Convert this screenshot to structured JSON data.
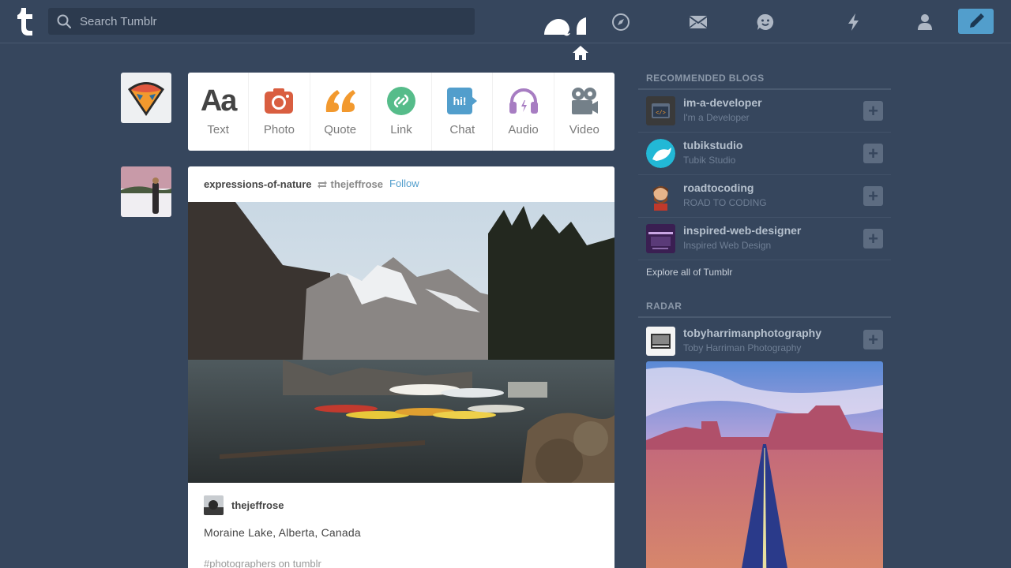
{
  "header": {
    "search_placeholder": "Search Tumblr",
    "nav_icons": [
      "home-icon",
      "explore-icon",
      "inbox-icon",
      "messaging-icon",
      "activity-icon",
      "account-icon"
    ],
    "compose_icon": "pencil-icon",
    "accent_color": "#529ecc",
    "background_color": "#36465d"
  },
  "post_types": [
    {
      "label": "Text",
      "icon": "text-icon",
      "color": "#444444"
    },
    {
      "label": "Photo",
      "icon": "camera-icon",
      "color": "#d95e40"
    },
    {
      "label": "Quote",
      "icon": "quote-icon",
      "color": "#f2992e"
    },
    {
      "label": "Link",
      "icon": "link-icon",
      "color": "#56bc8a"
    },
    {
      "label": "Chat",
      "icon": "chat-icon",
      "color": "#529ecc"
    },
    {
      "label": "Audio",
      "icon": "headphones-icon",
      "color": "#a77dc2"
    },
    {
      "label": "Video",
      "icon": "video-camera-icon",
      "color": "#748089"
    }
  ],
  "post": {
    "blog": "expressions-of-nature",
    "reblogged_from": "thejeffrose",
    "follow_label": "Follow",
    "caption_user": "thejeffrose",
    "caption": "Moraine Lake, Alberta, Canada",
    "tag": "#photographers on tumblr"
  },
  "sidebar": {
    "recommended_title": "RECOMMENDED BLOGS",
    "recommended": [
      {
        "name": "im-a-developer",
        "desc": "I'm a Developer"
      },
      {
        "name": "tubikstudio",
        "desc": "Tubik Studio"
      },
      {
        "name": "roadtocoding",
        "desc": "ROAD TO CODING"
      },
      {
        "name": "inspired-web-designer",
        "desc": "Inspired Web Design"
      }
    ],
    "follow_symbol": "+",
    "explore_label": "Explore all of Tumblr",
    "radar_title": "RADAR",
    "radar": {
      "name": "tobyharrimanphotography",
      "desc": "Toby Harriman Photography"
    }
  }
}
